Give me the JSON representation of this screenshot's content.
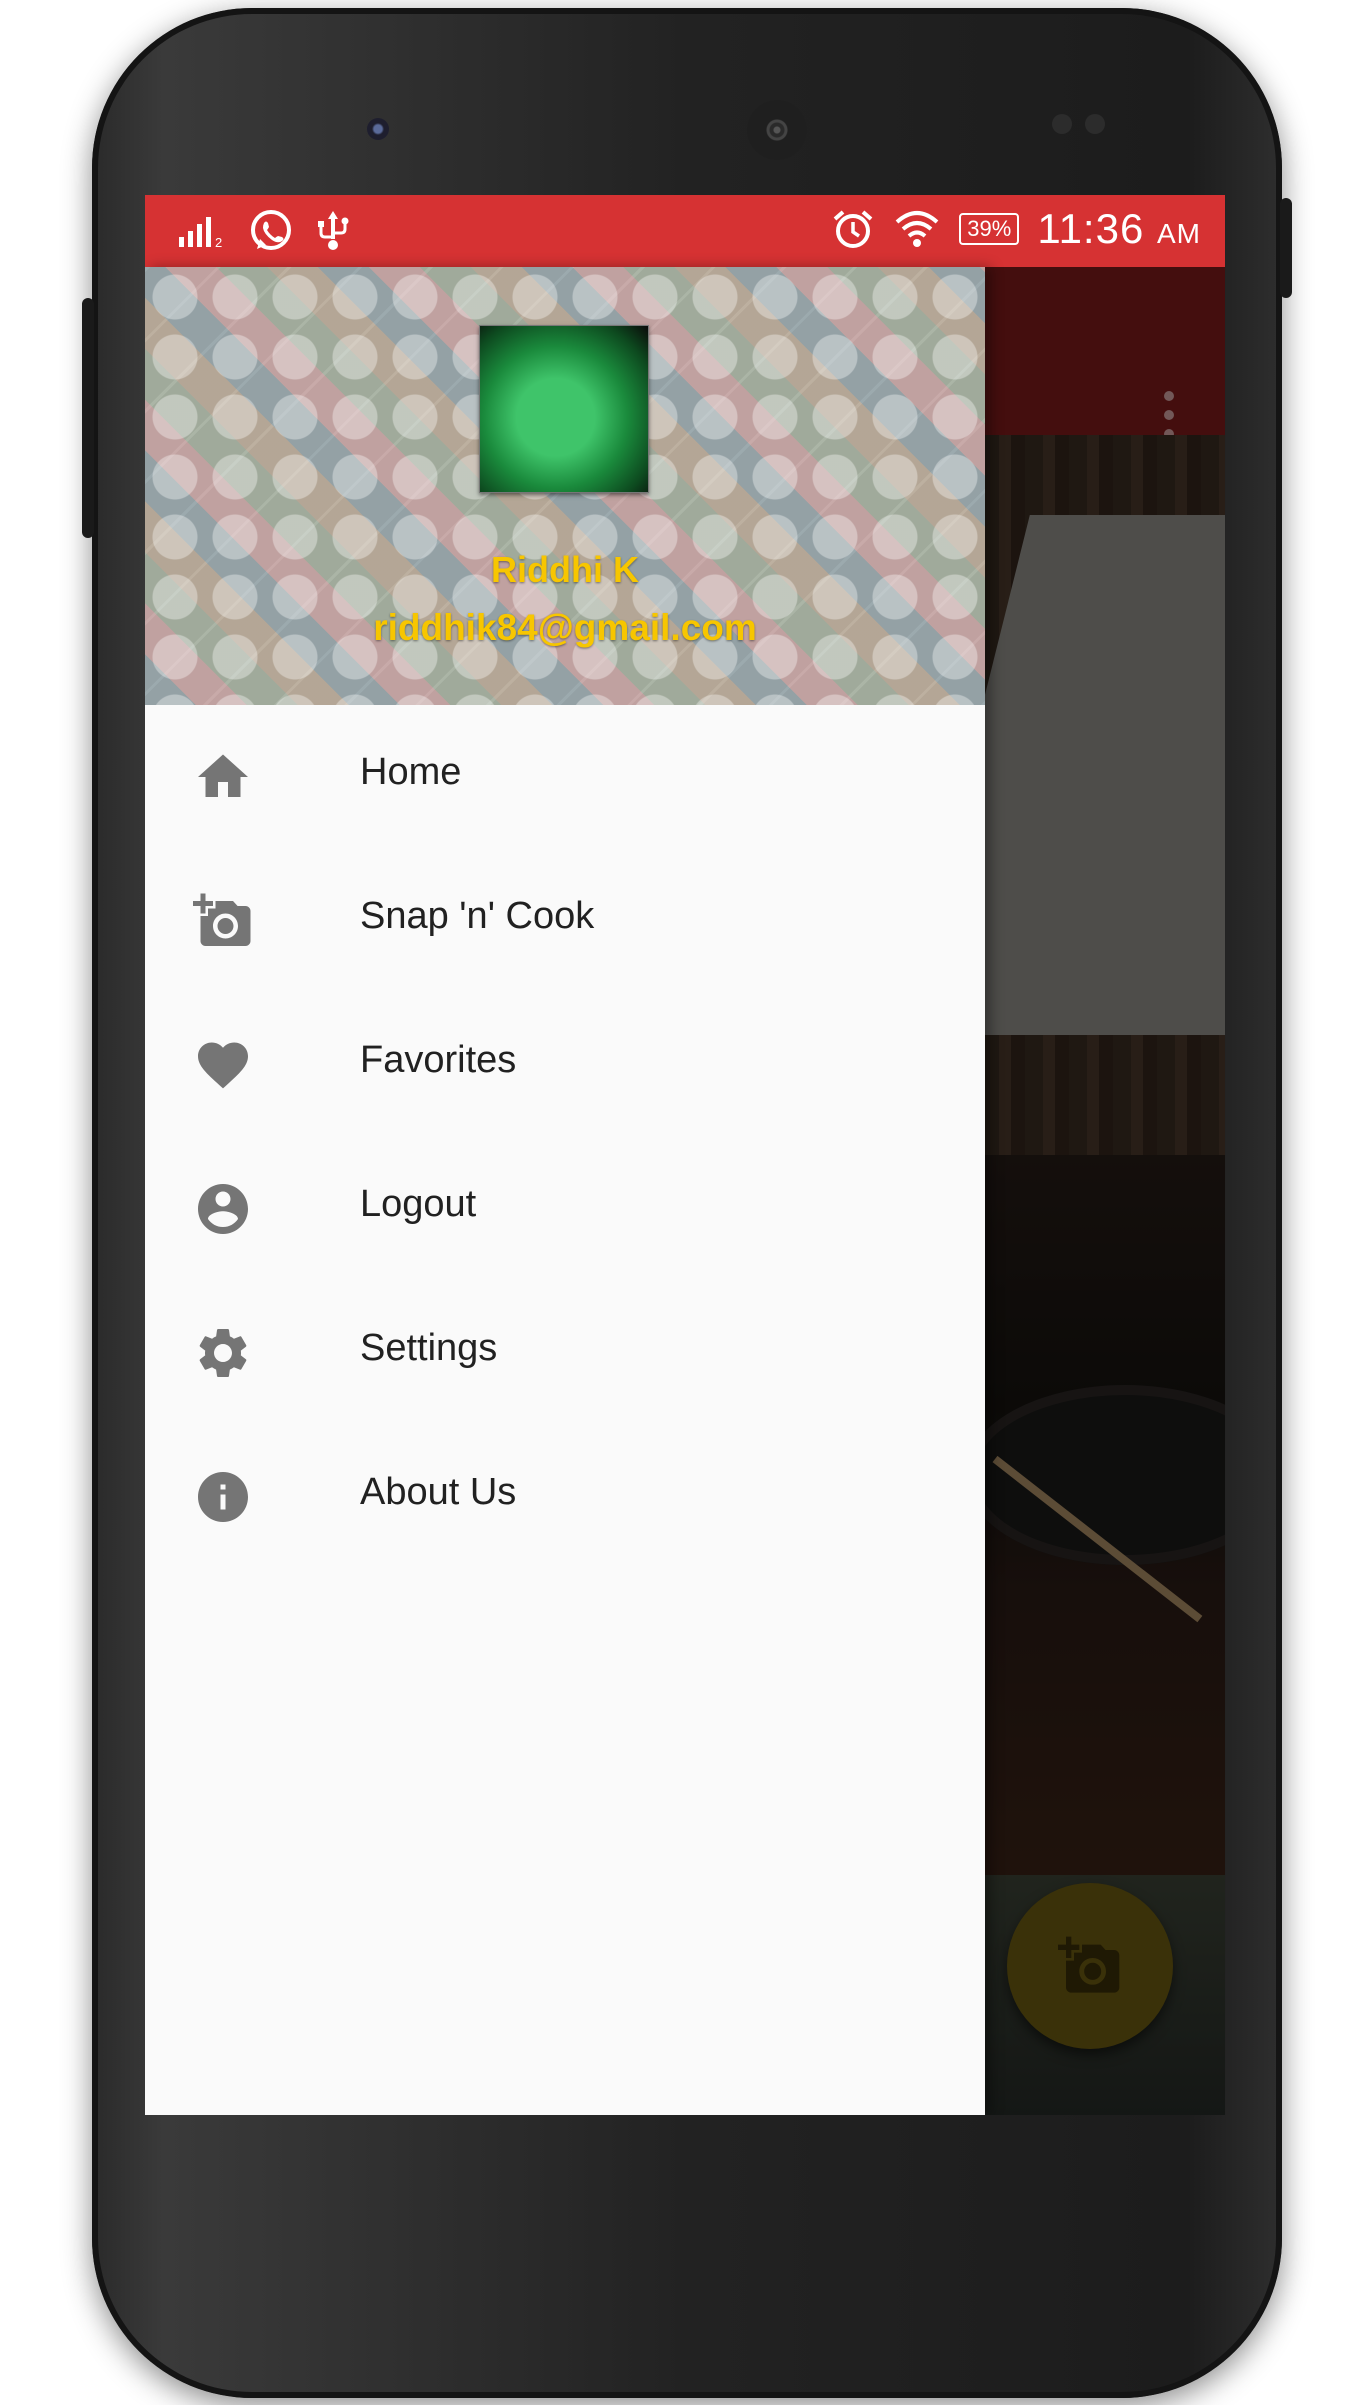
{
  "status_bar": {
    "signal_icon": "signal-icon",
    "notification_icons": [
      "whatsapp-icon",
      "usb-icon"
    ],
    "alarm_icon": "alarm-icon",
    "wifi_icon": "wifi-icon",
    "battery": "39%",
    "time": "11:36",
    "ampm": "AM"
  },
  "drawer": {
    "header": {
      "name": "Riddhi K",
      "email": "riddhik84@gmail.com"
    },
    "items": [
      {
        "label": "Home",
        "icon": "home-icon"
      },
      {
        "label": "Snap 'n' Cook",
        "icon": "add-a-photo-icon"
      },
      {
        "label": "Favorites",
        "icon": "heart-icon"
      },
      {
        "label": "Logout",
        "icon": "account-circle-icon"
      },
      {
        "label": "Settings",
        "icon": "gear-icon"
      },
      {
        "label": "About Us",
        "icon": "info-icon"
      }
    ]
  },
  "background_app": {
    "overflow_icon": "more-vert-icon",
    "fab_icon": "add-a-photo-icon"
  },
  "colors": {
    "status_bar": "#d63233",
    "toolbar": "#b02525",
    "header_text": "#f7c600",
    "fab": "#f2c416",
    "icon_gray": "#757575"
  }
}
